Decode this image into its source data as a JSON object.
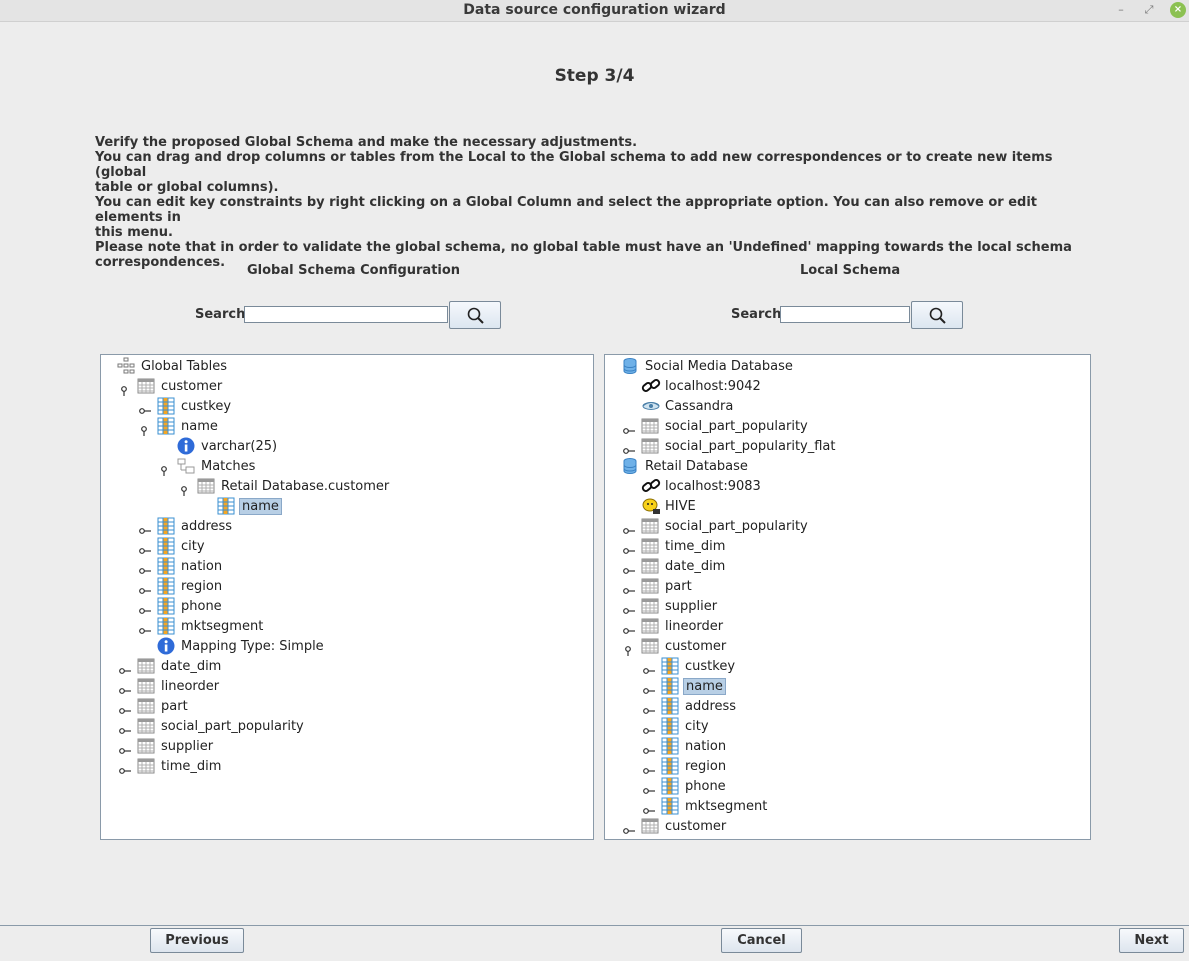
{
  "window": {
    "title": "Data source configuration wizard"
  },
  "step": "Step 3/4",
  "instructions": [
    "Verify the proposed Global Schema and make the necessary adjustments.",
    "You can drag and drop columns or tables from the Local to the Global schema to add new correspondences or to create new items (global",
    "table or global columns).",
    "You can edit key constraints by right clicking on a Global Column and select the appropriate option. You can also remove or edit elements in",
    "this menu.",
    "Please note that in order to validate the global schema, no global table must have an 'Undefined' mapping towards the local schema",
    "correspondences."
  ],
  "global_panel": {
    "title": "Global Schema Configuration",
    "search_label": "Search",
    "search_value": "",
    "nodes": [
      {
        "label": "Global Tables",
        "icon": "root-tree-icon",
        "depth": 0,
        "handle": "none"
      },
      {
        "label": "customer",
        "icon": "table-icon",
        "depth": 1,
        "handle": "open"
      },
      {
        "label": "custkey",
        "icon": "column-icon",
        "depth": 2,
        "handle": "closed"
      },
      {
        "label": "name",
        "icon": "column-icon",
        "depth": 2,
        "handle": "open"
      },
      {
        "label": "varchar(25)",
        "icon": "info-icon",
        "depth": 3,
        "handle": "none"
      },
      {
        "label": "Matches",
        "icon": "matches-icon",
        "depth": 3,
        "handle": "open"
      },
      {
        "label": "Retail Database.customer",
        "icon": "table-icon",
        "depth": 4,
        "handle": "open"
      },
      {
        "label": "name",
        "icon": "column-icon",
        "depth": 5,
        "handle": "none",
        "selected": true
      },
      {
        "label": "address",
        "icon": "column-icon",
        "depth": 2,
        "handle": "closed"
      },
      {
        "label": "city",
        "icon": "column-icon",
        "depth": 2,
        "handle": "closed"
      },
      {
        "label": "nation",
        "icon": "column-icon",
        "depth": 2,
        "handle": "closed"
      },
      {
        "label": "region",
        "icon": "column-icon",
        "depth": 2,
        "handle": "closed"
      },
      {
        "label": "phone",
        "icon": "column-icon",
        "depth": 2,
        "handle": "closed"
      },
      {
        "label": "mktsegment",
        "icon": "column-icon",
        "depth": 2,
        "handle": "closed"
      },
      {
        "label": "Mapping Type: Simple",
        "icon": "info-icon",
        "depth": 2,
        "handle": "none"
      },
      {
        "label": "date_dim",
        "icon": "table-icon",
        "depth": 1,
        "handle": "closed"
      },
      {
        "label": "lineorder",
        "icon": "table-icon",
        "depth": 1,
        "handle": "closed"
      },
      {
        "label": "part",
        "icon": "table-icon",
        "depth": 1,
        "handle": "closed"
      },
      {
        "label": "social_part_popularity",
        "icon": "table-icon",
        "depth": 1,
        "handle": "closed"
      },
      {
        "label": "supplier",
        "icon": "table-icon",
        "depth": 1,
        "handle": "closed"
      },
      {
        "label": "time_dim",
        "icon": "table-icon",
        "depth": 1,
        "handle": "closed"
      }
    ]
  },
  "local_panel": {
    "title": "Local Schema",
    "search_label": "Search",
    "search_value": "",
    "nodes": [
      {
        "label": "Social Media Database",
        "icon": "database-icon",
        "depth": 0,
        "handle": "none"
      },
      {
        "label": "localhost:9042",
        "icon": "link-icon",
        "depth": 1,
        "handle": "none"
      },
      {
        "label": "Cassandra",
        "icon": "cassandra-icon",
        "depth": 1,
        "handle": "none"
      },
      {
        "label": "social_part_popularity",
        "icon": "table-icon",
        "depth": 1,
        "handle": "closed"
      },
      {
        "label": "social_part_popularity_flat",
        "icon": "table-icon",
        "depth": 1,
        "handle": "closed"
      },
      {
        "label": "Retail Database",
        "icon": "database-icon",
        "depth": 0,
        "handle": "none"
      },
      {
        "label": "localhost:9083",
        "icon": "link-icon",
        "depth": 1,
        "handle": "none"
      },
      {
        "label": "HIVE",
        "icon": "hive-icon",
        "depth": 1,
        "handle": "none"
      },
      {
        "label": "social_part_popularity",
        "icon": "table-icon",
        "depth": 1,
        "handle": "closed"
      },
      {
        "label": "time_dim",
        "icon": "table-icon",
        "depth": 1,
        "handle": "closed"
      },
      {
        "label": "date_dim",
        "icon": "table-icon",
        "depth": 1,
        "handle": "closed"
      },
      {
        "label": "part",
        "icon": "table-icon",
        "depth": 1,
        "handle": "closed"
      },
      {
        "label": "supplier",
        "icon": "table-icon",
        "depth": 1,
        "handle": "closed"
      },
      {
        "label": "lineorder",
        "icon": "table-icon",
        "depth": 1,
        "handle": "closed"
      },
      {
        "label": "customer",
        "icon": "table-icon",
        "depth": 1,
        "handle": "open"
      },
      {
        "label": "custkey",
        "icon": "column-icon",
        "depth": 2,
        "handle": "closed"
      },
      {
        "label": "name",
        "icon": "column-icon",
        "depth": 2,
        "handle": "closed",
        "selected": true
      },
      {
        "label": "address",
        "icon": "column-icon",
        "depth": 2,
        "handle": "closed"
      },
      {
        "label": "city",
        "icon": "column-icon",
        "depth": 2,
        "handle": "closed"
      },
      {
        "label": "nation",
        "icon": "column-icon",
        "depth": 2,
        "handle": "closed"
      },
      {
        "label": "region",
        "icon": "column-icon",
        "depth": 2,
        "handle": "closed"
      },
      {
        "label": "phone",
        "icon": "column-icon",
        "depth": 2,
        "handle": "closed"
      },
      {
        "label": "mktsegment",
        "icon": "column-icon",
        "depth": 2,
        "handle": "closed"
      },
      {
        "label": "customer",
        "icon": "table-icon",
        "depth": 1,
        "handle": "closed"
      }
    ]
  },
  "buttons": {
    "previous": "Previous",
    "cancel": "Cancel",
    "next": "Next"
  }
}
